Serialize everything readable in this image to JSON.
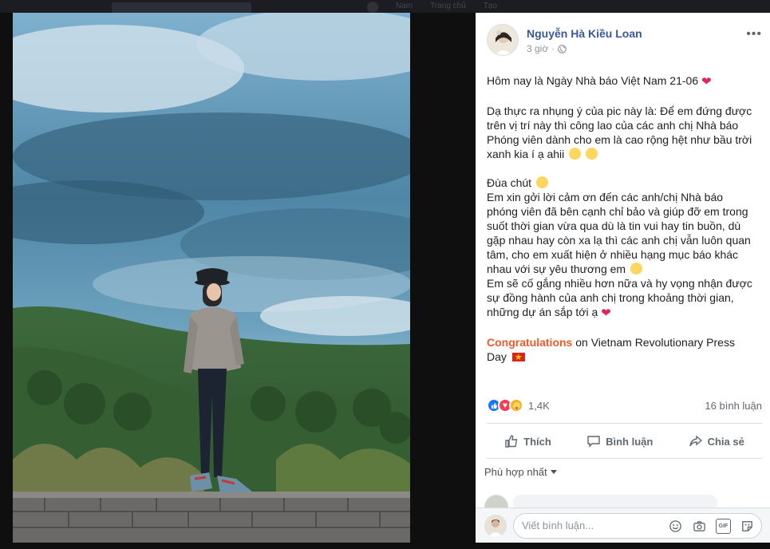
{
  "background_nav": {
    "home": "Nam",
    "page": "Trang chủ",
    "create": "Tạo"
  },
  "post": {
    "author": "Nguyễn Hà Kiều Loan",
    "time": "3 giờ",
    "privacy_icon": "globe-icon",
    "lines": {
      "l1": "Hôm nay là Ngày Nhà báo Việt Nam 21-06",
      "p2": "Dạ thực ra nhụng ý của pic này là: Để em đứng được trên vị trí này thì công lao của các anh chị Nhà báo Phóng viên dành cho em là cao rộng hệt như bầu trời xanh kia í ạ ahii",
      "p3a": "Đùa chút",
      "p3b": "Em xin gởi lời cảm ơn đến các anh/chị Nhà báo phóng viên đã bên cạnh chỉ bảo và giúp đỡ em trong suốt thời gian vừa qua dù là tin vui hay tin buồn, dù gặp nhau hay còn xa lạ thì các anh chị vẫn luôn quan tâm, cho em xuất hiện ở nhiều hạng mục báo khác nhau với sự yêu thương em",
      "p3c": "Em sẽ cố gắng nhiều hơn nữa và hy vọng nhận được sự đồng hành của anh chị trong khoảng thời gian, những dự án sắp tới ạ",
      "congrats_word": "Congratulations",
      "congrats_rest": "on Vietnam Revolutionary Press Day"
    }
  },
  "reactions": {
    "count": "1,4K",
    "comments": "16 bình luận"
  },
  "actions": {
    "like": "Thích",
    "comment": "Bình luận",
    "share": "Chia sẻ"
  },
  "sort": {
    "label": "Phù hợp nhất"
  },
  "composer": {
    "placeholder": "Viết bình luận..."
  },
  "colors": {
    "link": "#385898",
    "congrats": "#f05a28",
    "like_blue": "#1877f2",
    "love_red": "#f33e58"
  }
}
